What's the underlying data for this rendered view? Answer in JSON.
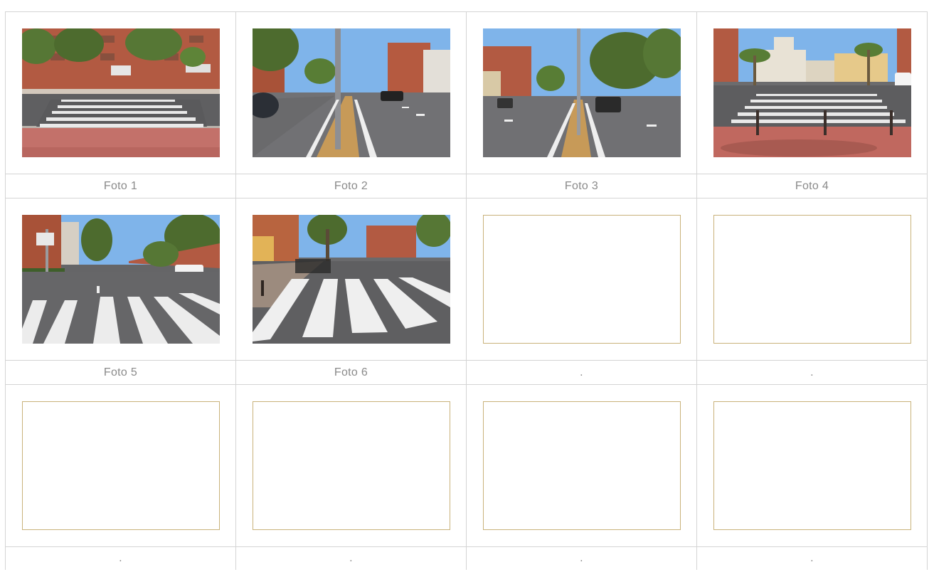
{
  "photos": [
    {
      "caption": "Foto 1",
      "scene": "crosswalk-street-buildings"
    },
    {
      "caption": "Foto 2",
      "scene": "avenue-median-pole"
    },
    {
      "caption": "Foto 3",
      "scene": "avenue-median-car"
    },
    {
      "caption": "Foto 4",
      "scene": "crosswalk-bollards-palms"
    },
    {
      "caption": "Foto 5",
      "scene": "crosswalk-avenue-trees"
    },
    {
      "caption": "Foto 6",
      "scene": "crosswalk-closeup"
    },
    {
      "caption": ".",
      "scene": "empty"
    },
    {
      "caption": ".",
      "scene": "empty"
    },
    {
      "caption": ".",
      "scene": "empty"
    },
    {
      "caption": ".",
      "scene": "empty"
    },
    {
      "caption": ".",
      "scene": "empty"
    },
    {
      "caption": ".",
      "scene": "empty"
    }
  ],
  "colors": {
    "border": "#d4d4d4",
    "caption": "#8a8a8a",
    "placeholder_border": "#c9b27a",
    "sky": "#7fb4ea",
    "brick": "#a9553d",
    "asphalt": "#6a6a6c",
    "tree": "#4d6b2e"
  }
}
